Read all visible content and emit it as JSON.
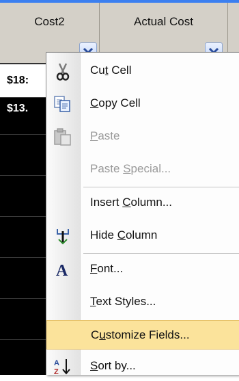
{
  "columns": {
    "cost2": {
      "label": "Cost2"
    },
    "actual_cost": {
      "label": "Actual Cost"
    }
  },
  "cells": {
    "row1_value": "$18:",
    "row2_value": "$13."
  },
  "menu": {
    "items": [
      {
        "pre": "Cu",
        "ul": "t",
        "post": " Cell",
        "icon": "scissors-icon",
        "enabled": true
      },
      {
        "pre": "",
        "ul": "C",
        "post": "opy Cell",
        "icon": "copy-icon",
        "enabled": true
      },
      {
        "pre": "",
        "ul": "P",
        "post": "aste",
        "icon": "paste-icon",
        "enabled": false
      },
      {
        "pre": "Paste ",
        "ul": "S",
        "post": "pecial...",
        "icon": "",
        "enabled": false
      },
      {
        "pre": "Insert ",
        "ul": "C",
        "post": "olumn...",
        "icon": "",
        "enabled": true
      },
      {
        "pre": "Hide ",
        "ul": "C",
        "post": "olumn",
        "icon": "hide-column-icon",
        "enabled": true
      },
      {
        "pre": "",
        "ul": "F",
        "post": "ont...",
        "icon": "font-icon",
        "enabled": true
      },
      {
        "pre": "",
        "ul": "T",
        "post": "ext Styles...",
        "icon": "",
        "enabled": true
      },
      {
        "pre": "C",
        "ul": "u",
        "post": "stomize Fields...",
        "icon": "",
        "enabled": true,
        "highlighted": true
      },
      {
        "pre": "",
        "ul": "S",
        "post": "ort by...",
        "icon": "sort-az-icon",
        "enabled": true
      }
    ]
  },
  "colors": {
    "highlight": "#fbe39b",
    "header_bg": "#d4d0c8",
    "cell_dark": "#000000"
  }
}
